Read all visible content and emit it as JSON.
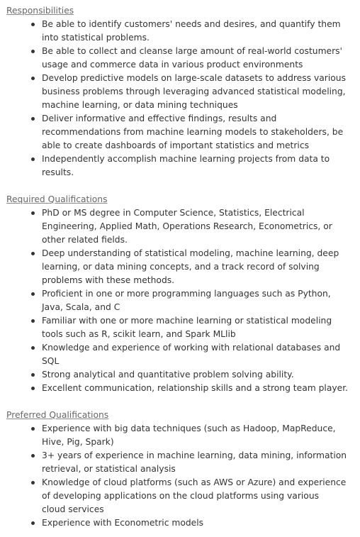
{
  "sections": [
    {
      "heading": "Responsibilities",
      "items": [
        [
          "Be able to identify customers' needs and desires, and quantify them",
          "into statistical problems."
        ],
        [
          "Be able to collect and cleanse large amount of real-world costumers'",
          "usage and commerce data in various product environments"
        ],
        [
          "Develop predictive models on large-scale datasets to address various",
          "business problems through leveraging advanced statistical modeling,",
          "machine learning, or data mining techniques"
        ],
        [
          "Deliver informative and effective findings, results and",
          "recommendations from machine learning models to stakeholders, be",
          "able to create dashboards of important statistics and metrics"
        ],
        [
          "Independently accomplish machine learning projects from data to",
          "results."
        ]
      ]
    },
    {
      "heading": "Required Qualifications",
      "items": [
        [
          "PhD or MS degree in Computer Science, Statistics, Electrical",
          "Engineering, Applied Math, Operations Research, Econometrics, or",
          "other related fields."
        ],
        [
          "Deep understanding of statistical modeling, machine learning, deep",
          "learning, or data mining concepts, and a track record of solving",
          "problems with these methods."
        ],
        [
          "Proficient in one or more programming languages such as Python,",
          "Java, Scala, and C"
        ],
        [
          "Familiar with one or more machine learning or statistical modeling",
          "tools such as R, scikit learn, and Spark MLlib"
        ],
        [
          "Knowledge and experience of working with relational databases and",
          "SQL"
        ],
        [
          "Strong analytical and quantitative problem solving ability."
        ],
        [
          "Excellent communication, relationship skills and a strong team player."
        ]
      ]
    },
    {
      "heading": "Preferred Qualifications",
      "items": [
        [
          "Experience with big data techniques (such as Hadoop, MapReduce,",
          "Hive, Pig, Spark)"
        ],
        [
          "3+ years of experience in machine learning, data mining, information",
          "retrieval, or statistical analysis"
        ],
        [
          "Knowledge of cloud platforms (such as AWS or Azure) and experience",
          "of developing applications on the cloud platforms using various",
          "cloud services"
        ],
        [
          "Experience with Econometric models"
        ]
      ]
    }
  ]
}
